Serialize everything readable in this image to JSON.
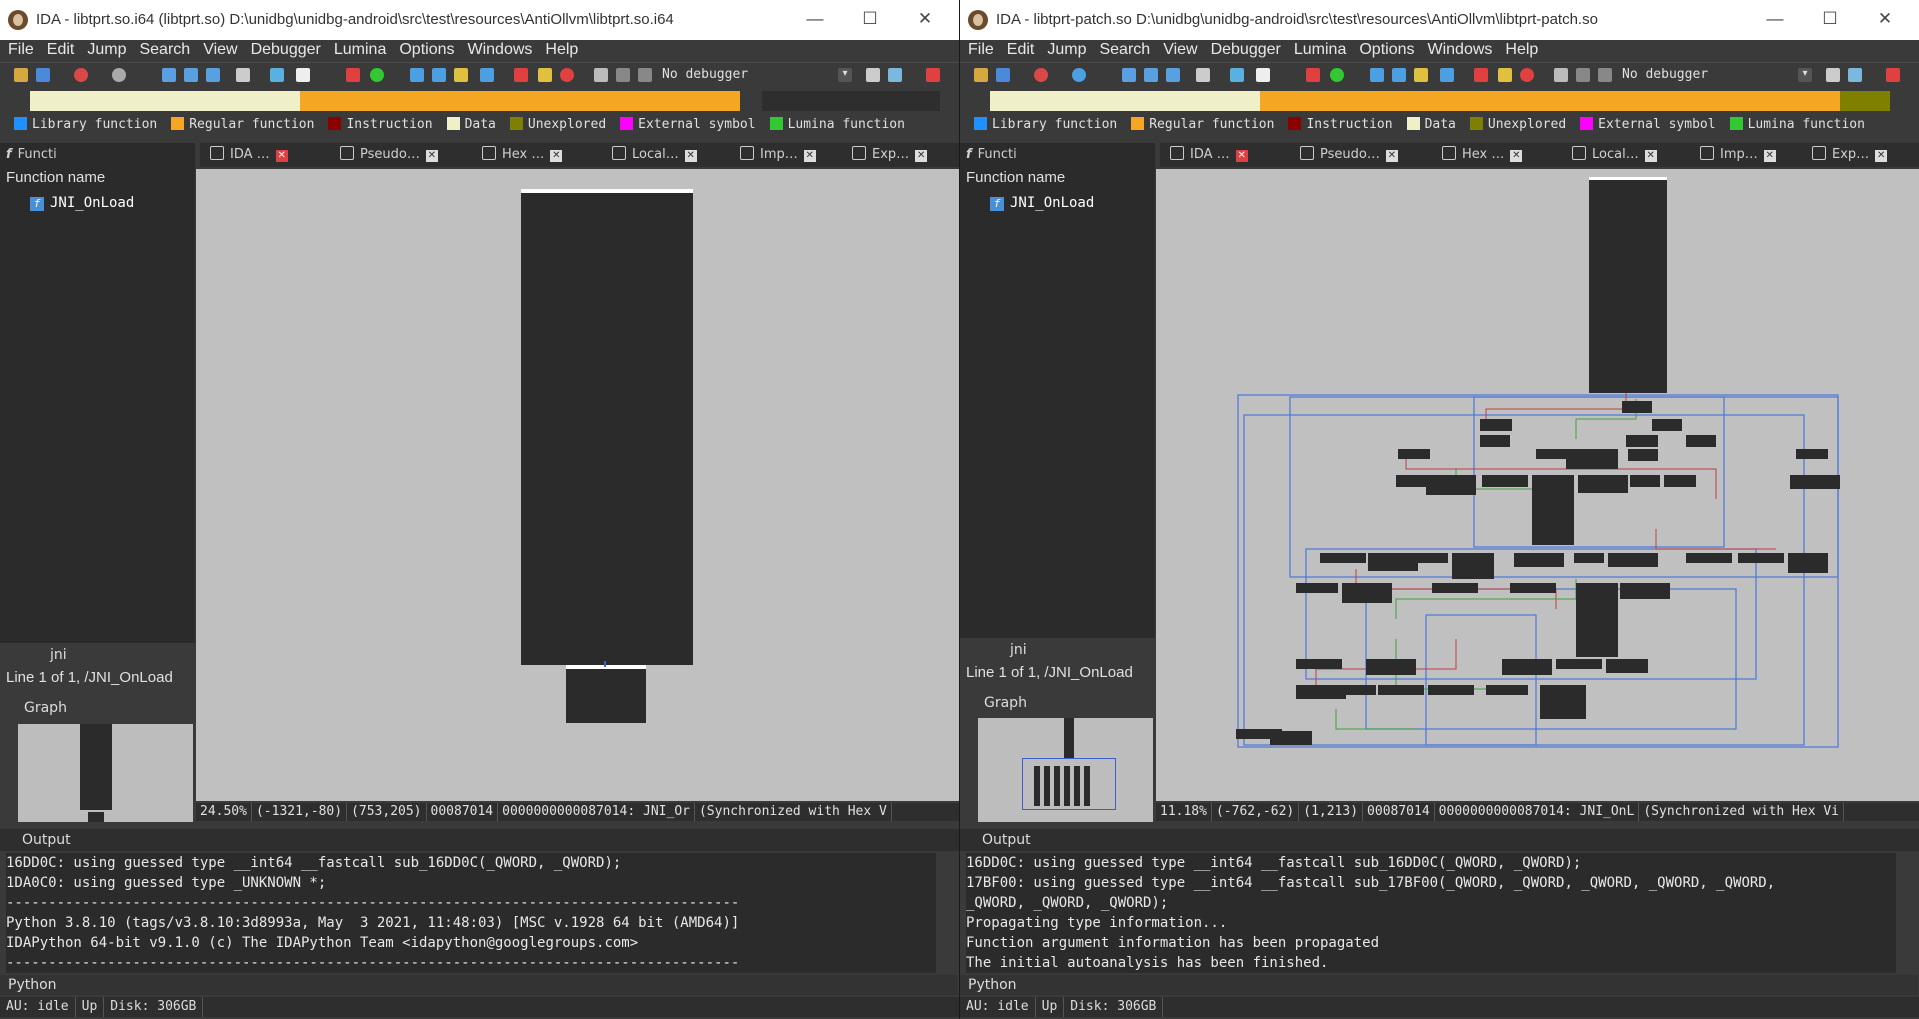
{
  "left": {
    "title": "IDA - libtprt.so.i64 (libtprt.so) D:\\unidbg\\unidbg-android\\src\\test\\resources\\AntiOllvm\\libtprt.so.i64",
    "menu": [
      "File",
      "Edit",
      "Jump",
      "Search",
      "View",
      "Debugger",
      "Lumina",
      "Options",
      "Windows",
      "Help"
    ],
    "debugger": "No debugger",
    "legend": [
      "Library function",
      "Regular function",
      "Instruction",
      "Data",
      "Unexplored",
      "External symbol",
      "Lumina function"
    ],
    "tabs": [
      "IDA …",
      "Pseudo…",
      "Hex …",
      "Local…",
      "Imp…",
      "Exp…"
    ],
    "functions_tab": "Functi",
    "fn_header": "Function name",
    "function": "JNI_OnLoad",
    "jni": "jni",
    "lineinfo": "Line 1 of 1, /JNI_OnLoad",
    "graph": "Graph",
    "status": [
      "24.50%",
      "(-1321,-80)",
      "(753,205)",
      "00087014",
      "0000000000087014: JNI_Or",
      "(Synchronized with Hex V"
    ],
    "output_label": "Output",
    "output_lines": [
      "16DD0C: using guessed type __int64 __fastcall sub_16DD0C(_QWORD, _QWORD);",
      "1DA0C0: using guessed type _UNKNOWN *;",
      "---------------------------------------------------------------------------------------",
      "Python 3.8.10 (tags/v3.8.10:3d8993a, May  3 2021, 11:48:03) [MSC v.1928 64 bit (AMD64)]",
      "IDAPython 64-bit v9.1.0 (c) The IDAPython Team <idapython@googlegroups.com>",
      "---------------------------------------------------------------------------------------"
    ],
    "python": "Python",
    "bottom": [
      "AU:  idle",
      "Up",
      "Disk: 306GB"
    ]
  },
  "right": {
    "title": "IDA - libtprt-patch.so D:\\unidbg\\unidbg-android\\src\\test\\resources\\AntiOllvm\\libtprt-patch.so",
    "menu": [
      "File",
      "Edit",
      "Jump",
      "Search",
      "View",
      "Debugger",
      "Lumina",
      "Options",
      "Windows",
      "Help"
    ],
    "debugger": "No debugger",
    "legend": [
      "Library function",
      "Regular function",
      "Instruction",
      "Data",
      "Unexplored",
      "External symbol",
      "Lumina function"
    ],
    "tabs": [
      "IDA …",
      "Pseudo…",
      "Hex …",
      "Local…",
      "Imp…",
      "Exp…"
    ],
    "functions_tab": "Functi",
    "fn_header": "Function name",
    "function": "JNI_OnLoad",
    "jni": "jni",
    "lineinfo": "Line 1 of 1, /JNI_OnLoad",
    "graph": "Graph",
    "status": [
      "11.18%",
      "(-762,-62)",
      "(1,213)",
      "00087014",
      "0000000000087014: JNI_OnL",
      "(Synchronized with Hex Vi"
    ],
    "output_label": "Output",
    "output_lines": [
      "16DD0C: using guessed type __int64 __fastcall sub_16DD0C(_QWORD, _QWORD);",
      "17BF00: using guessed type __int64 __fastcall sub_17BF00(_QWORD, _QWORD, _QWORD, _QWORD, _QWORD,",
      "_QWORD, _QWORD, _QWORD);",
      "Propagating type information...",
      "Function argument information has been propagated",
      "The initial autoanalysis has been finished."
    ],
    "python": "Python",
    "bottom": [
      "AU:  idle",
      "Up",
      "Disk: 306GB"
    ]
  },
  "colors": {
    "library": "#1e90ff",
    "regular": "#f5a623",
    "instruction": "#8b0000",
    "data": "#f0f0c8",
    "unexplored": "#808000",
    "external": "#ff00ff",
    "lumina": "#32c832"
  }
}
